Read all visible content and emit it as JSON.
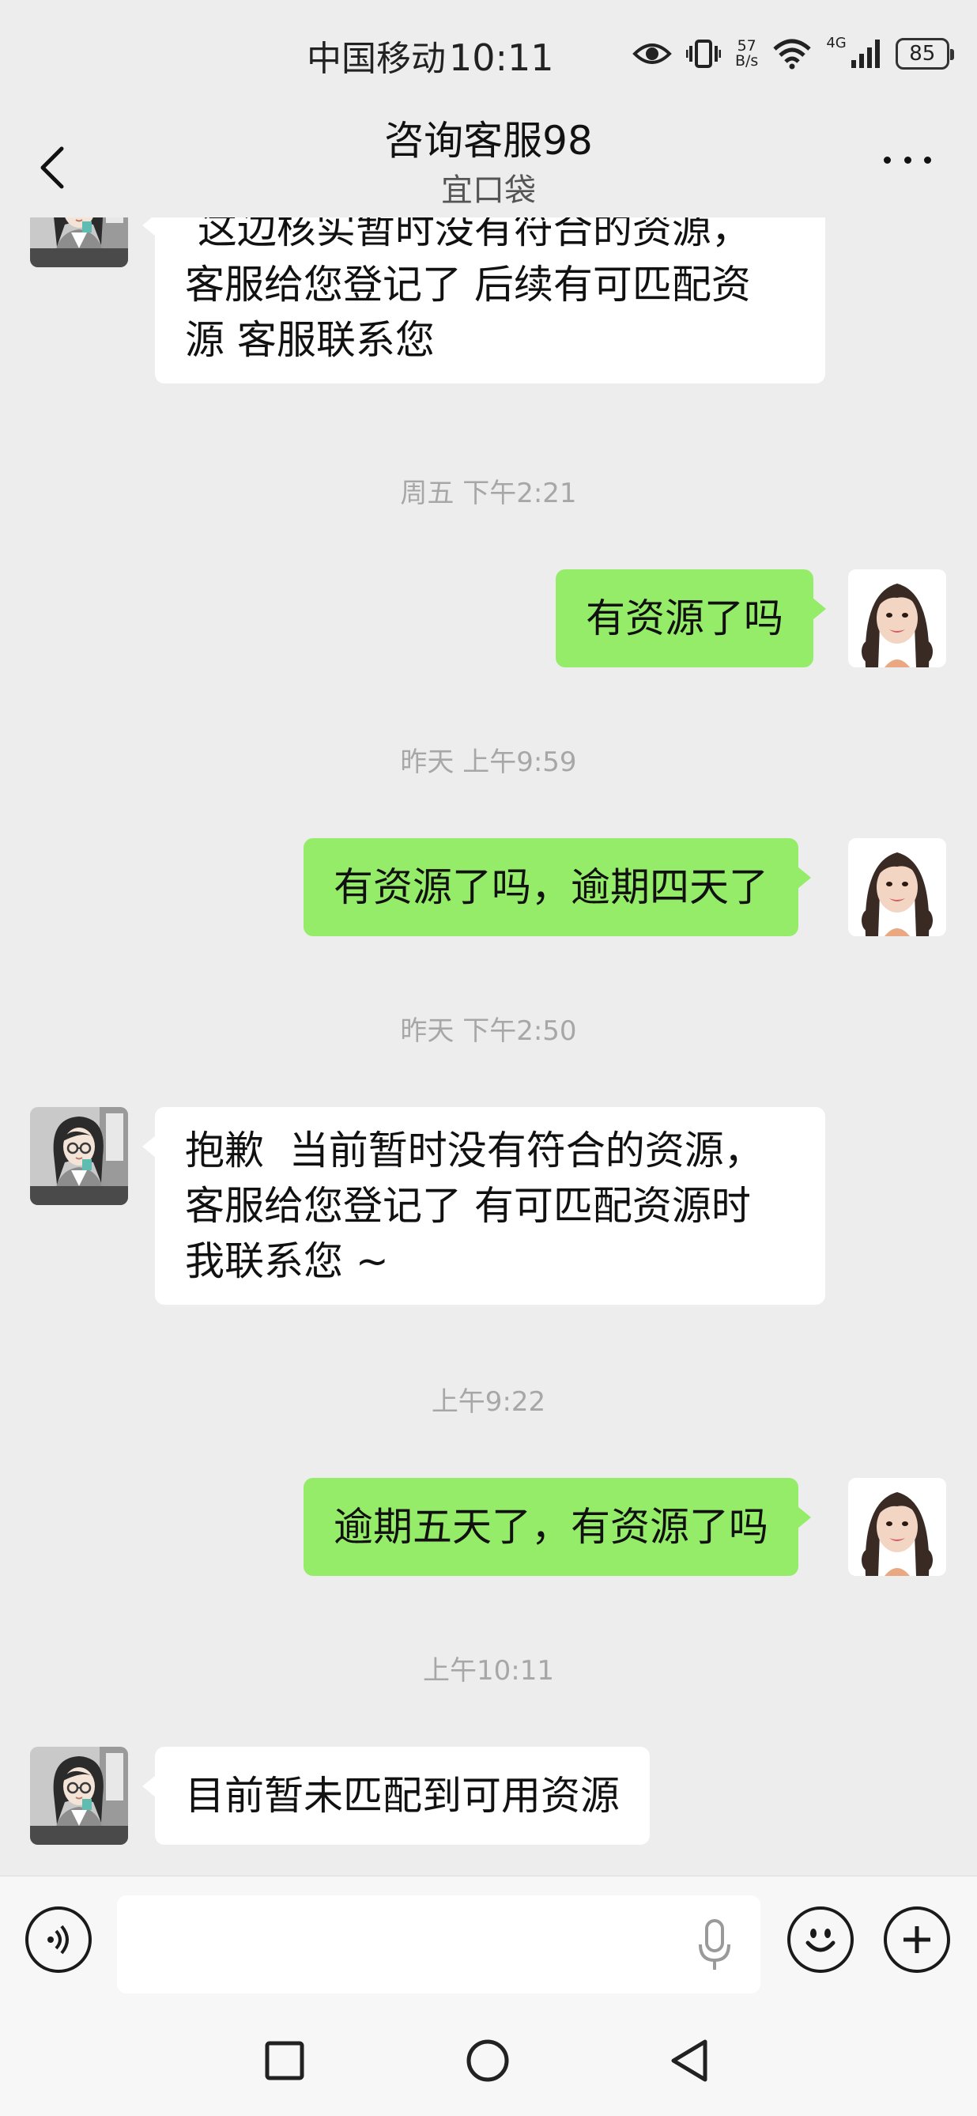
{
  "status_bar": {
    "carrier": "中国移动",
    "time": "10:11",
    "net_speed_value": "57",
    "net_speed_unit": "B/s",
    "network_gen": "4G",
    "battery": "85"
  },
  "header": {
    "title": "咨询客服98",
    "subtitle": "宜口袋"
  },
  "messages": [
    {
      "direction": "incoming",
      "text_lines": [
        " 这边核实暂时没有符合的资源，",
        "客服给您登记了 后续有可匹配资",
        "源 客服联系您"
      ]
    },
    {
      "timestamp": "周五 下午2:21"
    },
    {
      "direction": "outgoing",
      "text": "有资源了吗"
    },
    {
      "timestamp": "昨天 上午9:59"
    },
    {
      "direction": "outgoing",
      "text": "有资源了吗，逾期四天了"
    },
    {
      "timestamp": "昨天 下午2:50"
    },
    {
      "direction": "incoming",
      "text_lines": [
        "抱歉  当前暂时没有符合的资源，",
        "客服给您登记了 有可匹配资源时",
        "我联系您 ~"
      ]
    },
    {
      "timestamp": "上午9:22"
    },
    {
      "direction": "outgoing",
      "text": "逾期五天了，有资源了吗"
    },
    {
      "timestamp": "上午10:11"
    },
    {
      "direction": "incoming",
      "text": "目前暂未匹配到可用资源"
    }
  ],
  "input_bar": {
    "value": "",
    "placeholder": ""
  },
  "icons": {
    "status": [
      "eye-icon",
      "vibrate-icon",
      "wifi-icon",
      "signal-icon",
      "battery-icon"
    ],
    "header": [
      "back-arrow-icon",
      "more-icon"
    ],
    "input": [
      "voice-icon",
      "mic-icon",
      "emoji-icon",
      "plus-icon"
    ],
    "nav": [
      "recents-square-icon",
      "home-circle-icon",
      "back-triangle-icon"
    ]
  },
  "colors": {
    "background": "#ededed",
    "outgoing_bubble": "#95ec69",
    "incoming_bubble": "#ffffff",
    "timestamp_text": "#a7a7a7"
  }
}
